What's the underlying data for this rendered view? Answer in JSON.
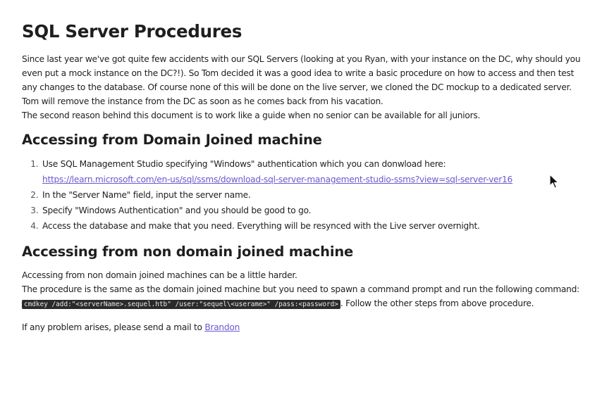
{
  "title": "SQL Server Procedures",
  "intro": {
    "p1": "Since last year we've got quite few accidents with our SQL Servers (looking at you Ryan, with your instance on the DC, why should you even put a mock instance on the DC?!). So Tom decided it was a good idea to write a basic procedure on how to access and then test any changes to the database. Of course none of this will be done on the live server, we cloned the DC mockup to a dedicated server.",
    "p2": "Tom will remove the instance from the DC as soon as he comes back from his vacation.",
    "p3": "The second reason behind this document is to work like a guide when no senior can be available for all juniors."
  },
  "section1": {
    "heading": "Accessing from Domain Joined machine",
    "steps": [
      {
        "text": "Use SQL Management Studio specifying \"Windows\" authentication which you can donwload here:",
        "link": "https://learn.microsoft.com/en-us/sql/ssms/download-sql-server-management-studio-ssms?view=sql-server-ver16"
      },
      {
        "text": "In the \"Server Name\" field, input the server name."
      },
      {
        "text": "Specify \"Windows Authentication\" and you should be good to go."
      },
      {
        "text": "Access the database and make that you need. Everything will be resynced with the Live server overnight."
      }
    ]
  },
  "section2": {
    "heading": "Accessing from non domain joined machine",
    "line1": "Accessing from non domain joined machines can be a little harder.",
    "line2_before": "The procedure is the same as the domain joined machine but you need to spawn a command prompt and run the following command: ",
    "command": "cmdkey /add:\"<serverName>.sequel.htb\" /user:\"sequel\\<userame>\" /pass:<password>",
    "line2_after": ". Follow the other steps from above procedure."
  },
  "footer": {
    "text": "If any problem arises, please send a mail to ",
    "link_label": "Brandon"
  }
}
